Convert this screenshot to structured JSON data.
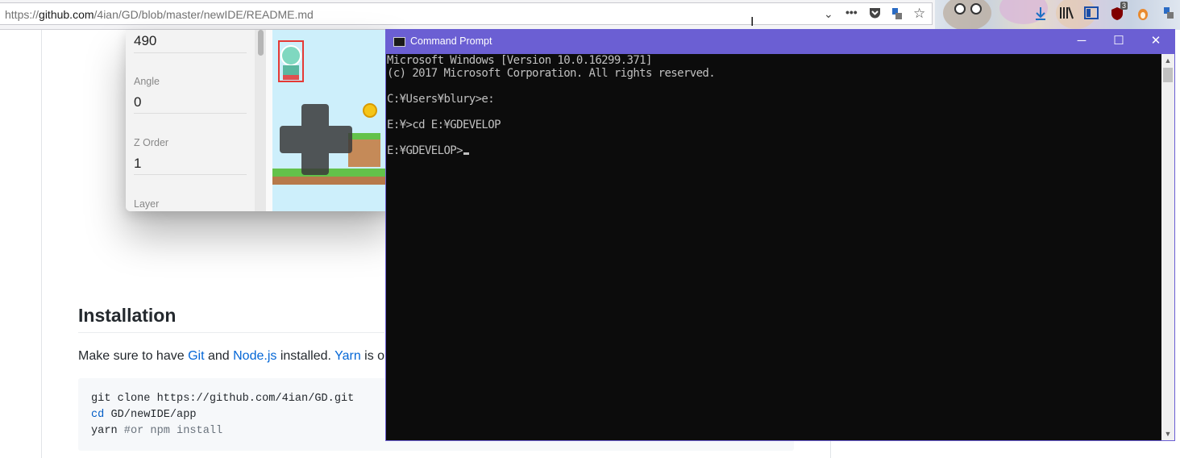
{
  "browser": {
    "url_prefix": "https://",
    "url_host": "github.com",
    "url_path": "/4ian/GD/blob/master/newIDE/README.md",
    "dropdown_icon": "chevron-down-icon",
    "more_icon": "ellipsis-icon",
    "badge_count": "3"
  },
  "editor_screenshot": {
    "value_top": "490",
    "angle_label": "Angle",
    "angle_value": "0",
    "zorder_label": "Z Order",
    "zorder_value": "1",
    "layer_label": "Layer"
  },
  "readme": {
    "heading": "Installation",
    "para_1": "Make sure to have ",
    "link_git": "Git",
    "para_2": " and ",
    "link_node": "Node.js",
    "para_3": " installed. ",
    "link_yarn": "Yarn",
    "para_4": " is op",
    "code_1": "git clone https://github.com/4ian/GD.git",
    "code_2_kw": "cd",
    "code_2_rest": " GD/newIDE/app",
    "code_3_cmd": "yarn ",
    "code_3_comment": "#or npm install"
  },
  "cmd_window": {
    "title": "Command Prompt",
    "minimize": "─",
    "maximize": "☐",
    "close": "✕",
    "lines": [
      "Microsoft Windows [Version 10.0.16299.371]",
      "(c) 2017 Microsoft Corporation. All rights reserved.",
      "",
      "C:¥Users¥blury>e:",
      "",
      "E:¥>cd E:¥GDEVELOP",
      "",
      "E:¥GDEVELOP>"
    ]
  },
  "colors": {
    "cmd_titlebar": "#6b5fd3",
    "console_bg": "#0c0c0c",
    "console_text": "#c0c0c0",
    "link": "#0366d6"
  }
}
